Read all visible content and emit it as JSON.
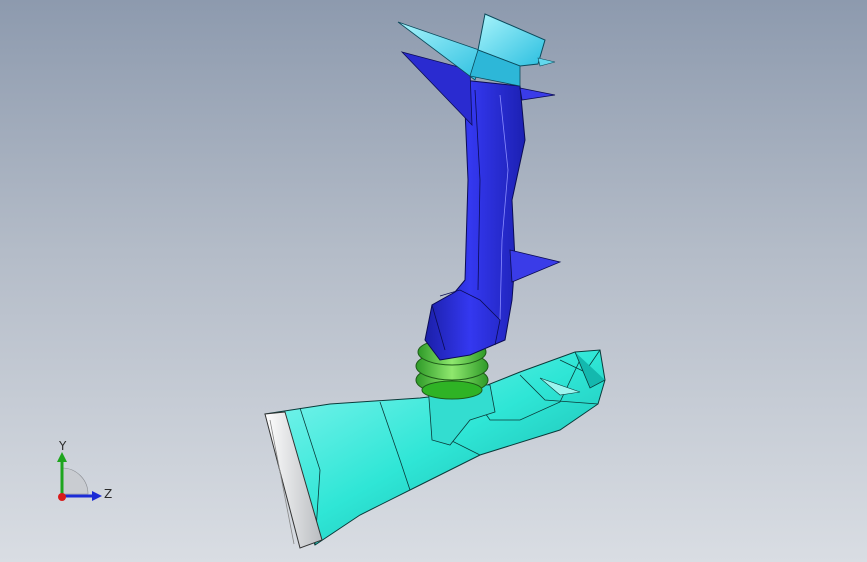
{
  "viewport": {
    "background_top": "#8d9aae",
    "background_bottom": "#d9dde3"
  },
  "model": {
    "parts": [
      {
        "name": "upper-duct",
        "color": "#2a2bd8"
      },
      {
        "name": "upper-duct-end-cap",
        "color": "#45d9e6"
      },
      {
        "name": "coupler-ring",
        "color": "#5fd04a"
      },
      {
        "name": "lower-housing",
        "color": "#2de8d4"
      },
      {
        "name": "lower-housing-flange",
        "color": "#eeeeee"
      }
    ]
  },
  "triad": {
    "y_label": "Y",
    "z_label": "Z",
    "y_color": "#1ea51e",
    "z_color": "#1b2bd6",
    "x_color": "#d81b1b"
  }
}
